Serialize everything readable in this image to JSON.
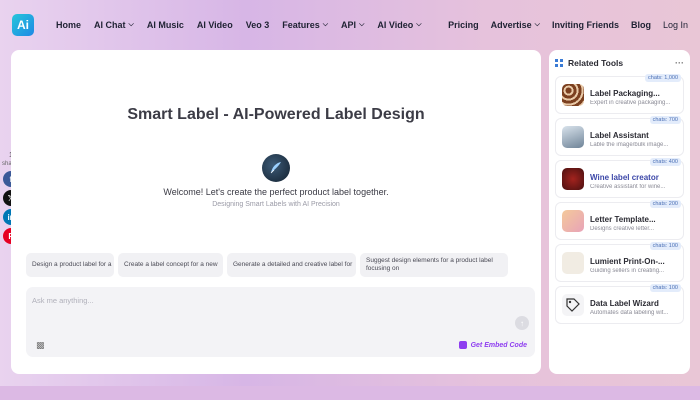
{
  "nav": {
    "logo": "Ai",
    "left": [
      {
        "label": "Home",
        "dropdown": false
      },
      {
        "label": "AI Chat",
        "dropdown": true
      },
      {
        "label": "AI Music",
        "dropdown": false
      },
      {
        "label": "AI Video",
        "dropdown": false
      },
      {
        "label": "Veo 3",
        "dropdown": false
      },
      {
        "label": "Features",
        "dropdown": true
      },
      {
        "label": "API",
        "dropdown": true
      },
      {
        "label": "AI Video",
        "dropdown": true
      }
    ],
    "right": [
      "Pricing",
      "Advertise",
      "Inviting Friends",
      "Blog",
      "Log In"
    ],
    "advertise_dropdown": true
  },
  "main": {
    "title": "Smart Label - AI-Powered Label Design",
    "welcome": "Welcome! Let's create the perfect product label together.",
    "subtitle": "Designing Smart Labels with AI Precision",
    "suggestions": [
      "Design a product label for a",
      "Create a label concept for a new",
      "Generate a detailed and creative label for",
      "Suggest design elements for a product label focusing on"
    ],
    "input_placeholder": "Ask me anything...",
    "embed_label": "Get Embed Code"
  },
  "share": {
    "count": "1",
    "label": "shares"
  },
  "sidebar": {
    "title": "Related Tools",
    "tools": [
      {
        "name": "Label Packaging...",
        "desc": "Expert in creative packaging...",
        "chats": "chats: 1,000",
        "highlight": false
      },
      {
        "name": "Label Assistant",
        "desc": "Lable the image/bulk image...",
        "chats": "chats: 700",
        "highlight": false
      },
      {
        "name": "Wine label creator",
        "desc": "Creative assistant for wine...",
        "chats": "chats: 400",
        "highlight": true
      },
      {
        "name": "Letter Template...",
        "desc": "Designs creative letter...",
        "chats": "chats: 200",
        "highlight": false
      },
      {
        "name": "Lumient Print-On-...",
        "desc": "Guiding sellers in creating...",
        "chats": "chats: 100",
        "highlight": false
      },
      {
        "name": "Data Label Wizard",
        "desc": "Automates data labeling wit...",
        "chats": "chats: 100",
        "highlight": false
      }
    ]
  },
  "colors": {
    "accent": "#8e3df0",
    "logo_gradient_start": "#26c6da",
    "logo_gradient_end": "#1e88e5"
  }
}
